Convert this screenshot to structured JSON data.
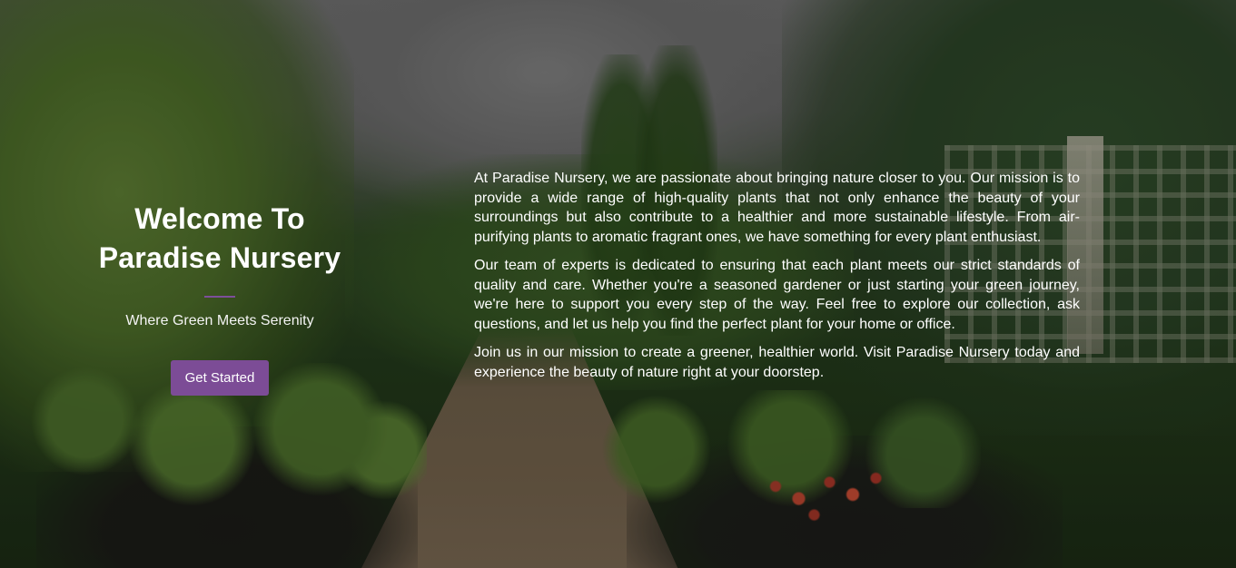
{
  "intro": {
    "title_line1": "Welcome To",
    "title_line2": "Paradise Nursery",
    "subtitle": "Where Green Meets Serenity",
    "cta_label": "Get Started"
  },
  "about": {
    "paragraphs": [
      "At Paradise Nursery, we are passionate about bringing nature closer to you. Our mission is to provide a wide range of high-quality plants that not only enhance the beauty of your surroundings but also contribute to a healthier and more sustainable lifestyle. From air-purifying plants to aromatic fragrant ones, we have something for every plant enthusiast.",
      "Our team of experts is dedicated to ensuring that each plant meets our strict standards of quality and care. Whether you're a seasoned gardener or just starting your green journey, we're here to support you every step of the way. Feel free to explore our collection, ask questions, and let us help you find the perfect plant for your home or office.",
      "Join us in our mission to create a greener, healthier world. Visit Paradise Nursery today and experience the beauty of nature right at your doorstep."
    ]
  },
  "colors": {
    "accent": "#7c4c96",
    "divider": "#7d4f9a",
    "text": "#ffffff"
  }
}
